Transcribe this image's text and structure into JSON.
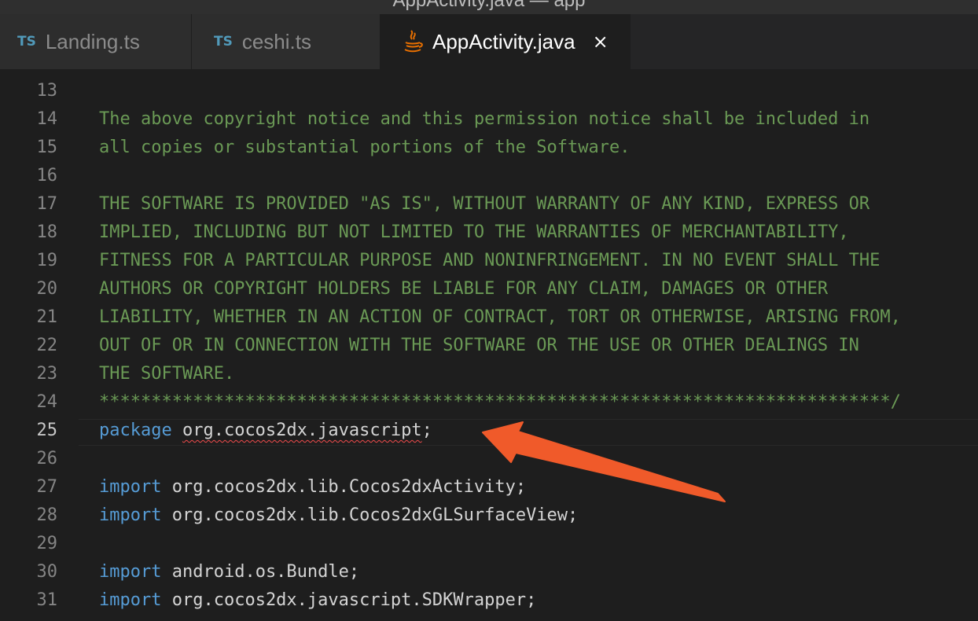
{
  "window": {
    "title": "AppActivity.java — app"
  },
  "tabs": [
    {
      "label": "Landing.ts",
      "icon": "ts-file-icon",
      "icon_text": "TS"
    },
    {
      "label": "ceshi.ts",
      "icon": "ts-file-icon",
      "icon_text": "TS"
    },
    {
      "label": "AppActivity.java",
      "icon": "java-file-icon",
      "close": "×",
      "active": true
    }
  ],
  "editor": {
    "lines": [
      {
        "number": "13",
        "text": ""
      },
      {
        "number": "14",
        "text": "The above copyright notice and this permission notice shall be included in"
      },
      {
        "number": "15",
        "text": "all copies or substantial portions of the Software."
      },
      {
        "number": "16",
        "text": ""
      },
      {
        "number": "17",
        "text": "THE SOFTWARE IS PROVIDED \"AS IS\", WITHOUT WARRANTY OF ANY KIND, EXPRESS OR"
      },
      {
        "number": "18",
        "text": "IMPLIED, INCLUDING BUT NOT LIMITED TO THE WARRANTIES OF MERCHANTABILITY,"
      },
      {
        "number": "19",
        "text": "FITNESS FOR A PARTICULAR PURPOSE AND NONINFRINGEMENT. IN NO EVENT SHALL THE"
      },
      {
        "number": "20",
        "text": "AUTHORS OR COPYRIGHT HOLDERS BE LIABLE FOR ANY CLAIM, DAMAGES OR OTHER"
      },
      {
        "number": "21",
        "text": "LIABILITY, WHETHER IN AN ACTION OF CONTRACT, TORT OR OTHERWISE, ARISING FROM,"
      },
      {
        "number": "22",
        "text": "OUT OF OR IN CONNECTION WITH THE SOFTWARE OR THE USE OR OTHER DEALINGS IN"
      },
      {
        "number": "23",
        "text": "THE SOFTWARE."
      },
      {
        "number": "24",
        "text": "****************************************************************************/"
      },
      {
        "number": "25",
        "keyword": "package",
        "text": "org.cocos2dx.javascript",
        "suffix": ";"
      },
      {
        "number": "26",
        "text": ""
      },
      {
        "number": "27",
        "keyword": "import",
        "text": "org.cocos2dx.lib.Cocos2dxActivity;"
      },
      {
        "number": "28",
        "keyword": "import",
        "text": "org.cocos2dx.lib.Cocos2dxGLSurfaceView;"
      },
      {
        "number": "29",
        "text": ""
      },
      {
        "number": "30",
        "keyword": "import",
        "text": "android.os.Bundle;"
      },
      {
        "number": "31",
        "keyword": "import",
        "text": "org.cocos2dx.javascript.SDKWrapper;"
      }
    ]
  },
  "colors": {
    "background": "#1e1e1e",
    "comment": "#6a9955",
    "keyword": "#569cd6",
    "error_squiggle": "#f14c4c",
    "annotation_arrow": "#f05a2a"
  }
}
